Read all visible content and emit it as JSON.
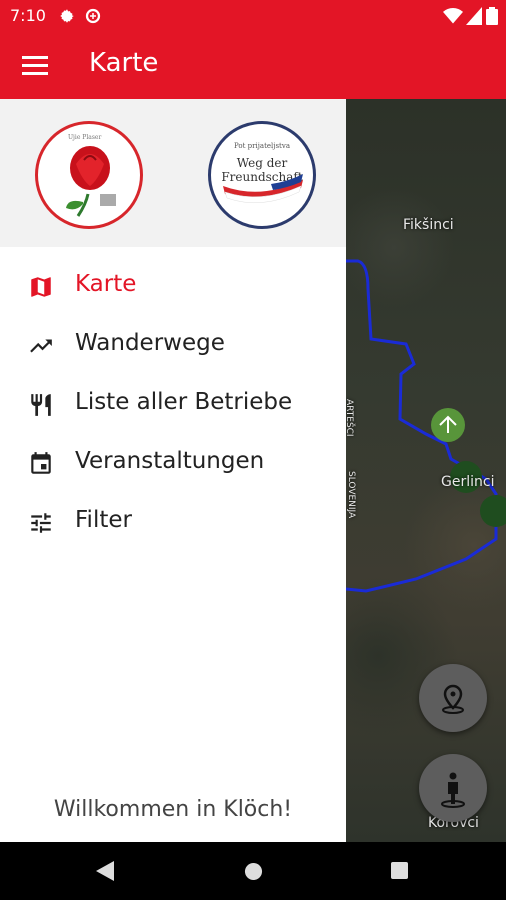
{
  "status_bar": {
    "time": "7:10"
  },
  "app_bar": {
    "title": "Karte"
  },
  "drawer": {
    "logo_rose_tag": "Ujie Plaser",
    "logo_friendship_line1": "Pot prijateljstva",
    "logo_friendship_line2": "Weg der Freundschaft",
    "items": [
      {
        "label": "Karte",
        "icon": "map-icon",
        "active": true
      },
      {
        "label": "Wanderwege",
        "icon": "trending-icon"
      },
      {
        "label": "Liste aller Betriebe",
        "icon": "fork-knife-icon"
      },
      {
        "label": "Veranstaltungen",
        "icon": "calendar-icon"
      },
      {
        "label": "Filter",
        "icon": "tune-icon"
      }
    ],
    "footer": "Willkommen in Klöch!"
  },
  "map": {
    "places": [
      "Fikšinci",
      "Gerlinci",
      "Korovci"
    ],
    "road_labels": [
      "ARTEŠCI",
      "SLOVENIJA"
    ]
  },
  "colors": {
    "accent": "#e31526",
    "route": "#1a2bd6",
    "marker": "#1f4d1f"
  }
}
